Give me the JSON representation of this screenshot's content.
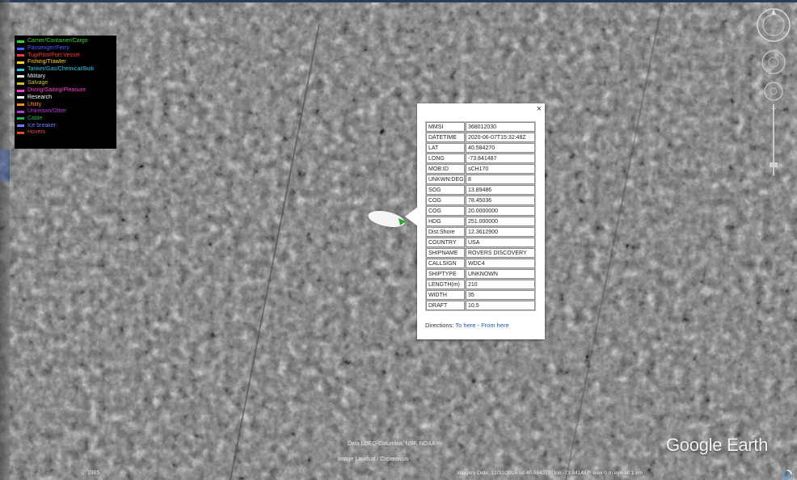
{
  "colors": {
    "legend_bg": "#000000",
    "popup_bg": "#ffffff",
    "link": "#1a55c8",
    "vessel_marker": "#22aa33"
  },
  "legend": {
    "items": [
      {
        "label": "Carrier/Container/Cargo",
        "color": "#2fd62f"
      },
      {
        "label": "Passenger/Ferry",
        "color": "#4a5cff"
      },
      {
        "label": "Tug/Pilot/Port Vessel",
        "color": "#ff3a3a"
      },
      {
        "label": "Fishing/Trawler",
        "color": "#ffd020"
      },
      {
        "label": "Tanker/Gas/Chemical/Bulk",
        "color": "#29c7e6"
      },
      {
        "label": "Military",
        "color": "#e8e8e8"
      },
      {
        "label": "Salvage",
        "color": "#c6c618"
      },
      {
        "label": "Diving/Sailing/Pleasure",
        "color": "#ff3ad0"
      },
      {
        "label": "Research",
        "color": "#ffffff"
      },
      {
        "label": "Utility",
        "color": "#ff8c1a"
      },
      {
        "label": "Unknown/Other",
        "color": "#b43ad6"
      },
      {
        "label": "Cable",
        "color": "#24b24a"
      },
      {
        "label": "Ice breaker",
        "color": "#6a7cff"
      },
      {
        "label": "Hovers",
        "color": "#e24a30"
      }
    ]
  },
  "popup": {
    "close_glyph": "×",
    "rows": [
      {
        "key": "MMSI",
        "value": "368012030"
      },
      {
        "key": "DATETIME",
        "value": "2020-06-07T15:32:48Z"
      },
      {
        "key": "LAT",
        "value": "40.584270"
      },
      {
        "key": "LONG",
        "value": "-73.841487"
      },
      {
        "key": "MOB:ID",
        "value": "sCH170"
      },
      {
        "key": "UNKWN:DEG",
        "value": "8"
      },
      {
        "key": "SOG",
        "value": "13.89486"
      },
      {
        "key": "COG",
        "value": "78.45036"
      },
      {
        "key": "COG",
        "value": "20.0000000"
      },
      {
        "key": "HDG",
        "value": "251.000000"
      },
      {
        "key": "Dist:Shore",
        "value": "12.3612900"
      },
      {
        "key": "COUNTRY",
        "value": "USA"
      },
      {
        "key": "SHIPNAME",
        "value": "ROVERS DISCOVERY"
      },
      {
        "key": "CALLSIGN",
        "value": "WDC4"
      },
      {
        "key": "SHIPTYPE",
        "value": "UNKNOWN"
      },
      {
        "key": "LENGTH(m)",
        "value": "210"
      },
      {
        "key": "WIDTH",
        "value": "35"
      },
      {
        "key": "DRAFT",
        "value": "10.5"
      }
    ],
    "directions_label": "Directions:",
    "directions_to": "To here",
    "directions_sep": " - ",
    "directions_from": "From here"
  },
  "map": {
    "attribution_line1": "Data LDEO-Columbia, NSF, NOAA",
    "attribution_line2": "Image Landsat / Copernicus",
    "logo": "Google Earth",
    "mini_logo": "ⓖ 1985",
    "status": "Imagery Date: 12/31/2016    lat 40.584270°  lon -73.841487°  elev 0 m   eye alt 1 km"
  }
}
